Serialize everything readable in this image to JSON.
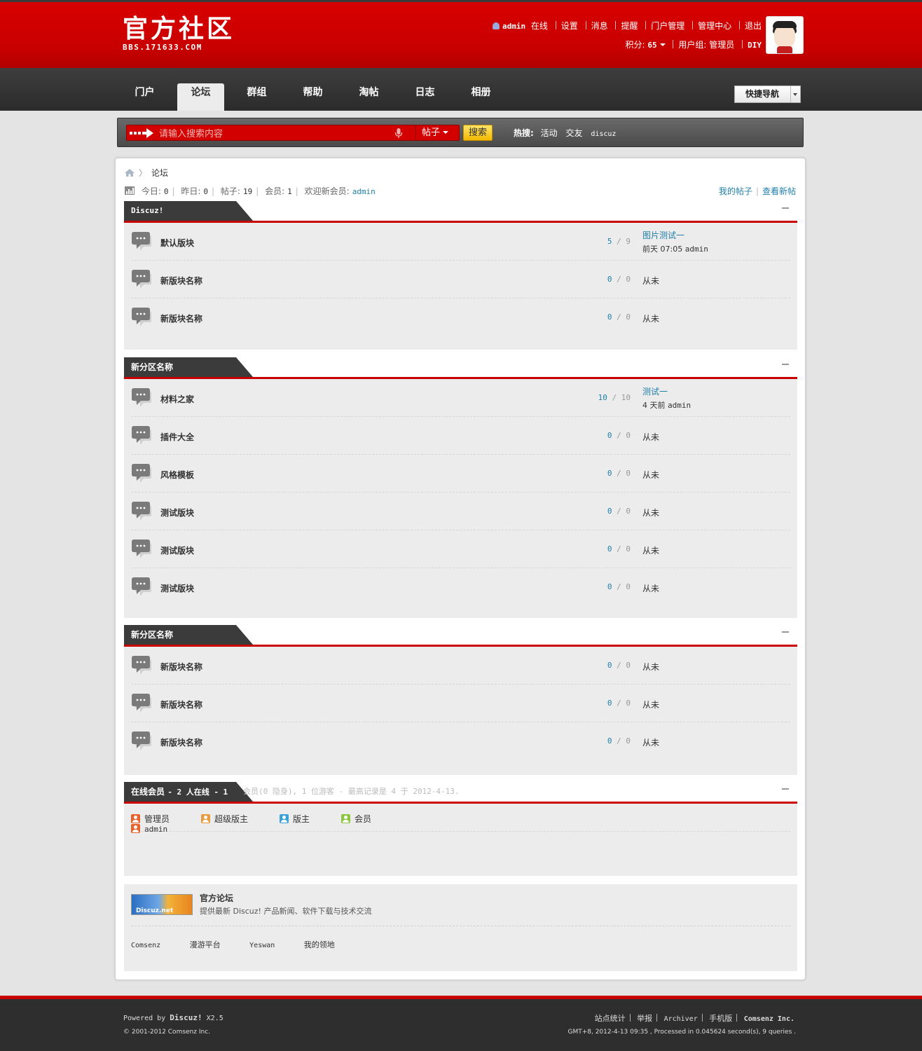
{
  "header": {
    "logo_main": "官方社区",
    "logo_sub": "BBS.171633.COM",
    "username": "admin",
    "online": "在线",
    "links": [
      "设置",
      "消息",
      "提醒",
      "门户管理",
      "管理中心",
      "退出"
    ],
    "points_label": "积分:",
    "points_value": "65",
    "usergroup_label": "用户组:",
    "usergroup_value": "管理员",
    "diy": "DIY"
  },
  "nav": {
    "items": [
      "门户",
      "论坛",
      "群组",
      "帮助",
      "淘帖",
      "日志",
      "相册"
    ],
    "active_index": 1,
    "quicknav": "快捷导航"
  },
  "search": {
    "placeholder": "请输入搜索内容",
    "type": "帖子",
    "button": "搜索",
    "hot_label": "热搜:",
    "hot_words": [
      "活动",
      "交友",
      "discuz"
    ]
  },
  "breadcrumb": {
    "current": "论坛"
  },
  "stats": {
    "today_label": "今日:",
    "today": "0",
    "yesterday_label": "昨日:",
    "yesterday": "0",
    "posts_label": "帖子:",
    "posts": "19",
    "members_label": "会员:",
    "members": "1",
    "welcome_label": "欢迎新会员:",
    "newest_member": "admin"
  },
  "toplinks": {
    "my_posts": "我的帖子",
    "new_posts": "查看新帖"
  },
  "sections": [
    {
      "title": "Discuz!",
      "forums": [
        {
          "name": "默认版块",
          "threads": "5",
          "posts": "9",
          "last_title": "图片测试一",
          "last_time": "前天 07:05",
          "last_user": "admin"
        },
        {
          "name": "新版块名称",
          "threads": "0",
          "posts": "0",
          "last_text": "从未"
        },
        {
          "name": "新版块名称",
          "threads": "0",
          "posts": "0",
          "last_text": "从未"
        }
      ]
    },
    {
      "title": "新分区名称",
      "forums": [
        {
          "name": "材料之家",
          "threads": "10",
          "posts": "10",
          "last_title": "测试一",
          "last_time": "4 天前",
          "last_user": "admin"
        },
        {
          "name": "插件大全",
          "threads": "0",
          "posts": "0",
          "last_text": "从未"
        },
        {
          "name": "风格模板",
          "threads": "0",
          "posts": "0",
          "last_text": "从未"
        },
        {
          "name": "测试版块",
          "threads": "0",
          "posts": "0",
          "last_text": "从未"
        },
        {
          "name": "测试版块",
          "threads": "0",
          "posts": "0",
          "last_text": "从未"
        },
        {
          "name": "测试版块",
          "threads": "0",
          "posts": "0",
          "last_text": "从未"
        }
      ]
    },
    {
      "title": "新分区名称",
      "forums": [
        {
          "name": "新版块名称",
          "threads": "0",
          "posts": "0",
          "last_text": "从未"
        },
        {
          "name": "新版块名称",
          "threads": "0",
          "posts": "0",
          "last_text": "从未"
        },
        {
          "name": "新版块名称",
          "threads": "0",
          "posts": "0",
          "last_text": "从未"
        }
      ]
    }
  ],
  "online": {
    "title": "在线会员",
    "summary": "- 2 人在线 - 1",
    "rest": "会员(0 隐身), 1 位游客 - 最高记录是 4 于 2012-4-13.",
    "legend": [
      {
        "label": "管理员",
        "color": "#e8622c"
      },
      {
        "label": "超级版主",
        "color": "#e89a3c"
      },
      {
        "label": "版主",
        "color": "#3aa0d8"
      },
      {
        "label": "会员",
        "color": "#8cc63e"
      }
    ],
    "users": [
      "admin"
    ]
  },
  "links": {
    "badge": "Discuz.net",
    "name": "官方论坛",
    "desc": "提供最新 Discuz! 产品新闻、软件下载与技术交流",
    "text_links": [
      "Comsenz",
      "漫游平台",
      "Yeswan",
      "我的领地"
    ]
  },
  "footer": {
    "powered_prefix": "Powered by",
    "powered_name": "Discuz!",
    "version": "X2.5",
    "copyright": "© 2001-2012 Comsenz Inc.",
    "links": [
      "站点统计",
      "举报",
      "Archiver",
      "手机版"
    ],
    "company": "Comsenz Inc.",
    "debug": "GMT+8, 2012-4-13 09:35 , Processed in 0.045624 second(s), 9 queries ."
  }
}
